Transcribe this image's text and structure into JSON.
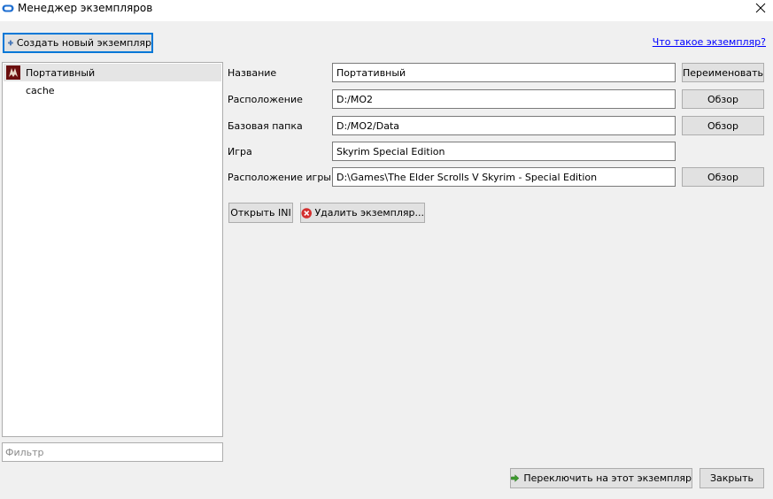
{
  "window": {
    "title": "Менеджер экземпляров",
    "close_symbol": "×",
    "icon": "mo2-logo-icon"
  },
  "toolbar": {
    "create_label": "Создать новый экземпляр",
    "help_link": "Что такое экземпляр?"
  },
  "instances": [
    {
      "label": "Портативный",
      "selected": true,
      "icon": "skyrim-instance-icon"
    },
    {
      "label": "cache",
      "selected": false
    }
  ],
  "filter": {
    "placeholder": "Фильтр",
    "value": ""
  },
  "details": {
    "name_label": "Название",
    "name_value": "Портативный",
    "rename_button": "Переименовать",
    "location_label": "Расположение",
    "location_value": "D:/MO2",
    "location_browse": "Обзор",
    "base_label": "Базовая папка",
    "base_value": "D:/MO2/Data",
    "base_browse": "Обзор",
    "game_label": "Игра",
    "game_value": "Skyrim Special Edition",
    "game_location_label": "Расположение игры",
    "game_location_value": "D:\\Games\\The Elder Scrolls V Skyrim - Special Edition",
    "game_location_browse": "Обзор"
  },
  "actions": {
    "open_ini": "Открыть INI",
    "delete_instance": "Удалить экземпляр..."
  },
  "footer": {
    "switch_button": "Переключить на этот экземпляр",
    "close_button": "Закрыть"
  },
  "colors": {
    "accent": "#0078d7",
    "link": "#0000ff",
    "delete_red": "#d32f2f",
    "switch_green": "#3c9a2c"
  }
}
